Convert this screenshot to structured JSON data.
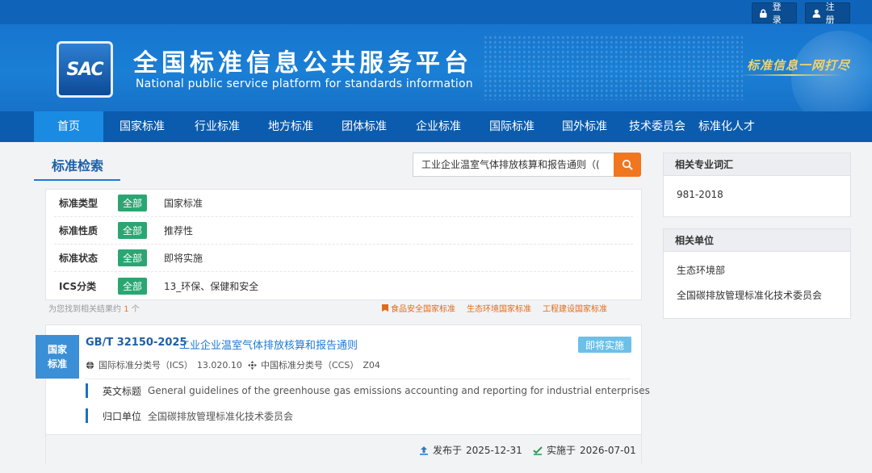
{
  "header": {
    "login_label": "登录",
    "register_label": "注册",
    "logo_text": "SAC",
    "site_title": "全国标准信息公共服务平台",
    "site_subtitle": "National public service platform  for standards information",
    "slogan": "标准信息一网打尽"
  },
  "nav": {
    "items": [
      {
        "label": "首页"
      },
      {
        "label": "国家标准"
      },
      {
        "label": "行业标准"
      },
      {
        "label": "地方标准"
      },
      {
        "label": "团体标准"
      },
      {
        "label": "企业标准"
      },
      {
        "label": "国际标准"
      },
      {
        "label": "国外标准"
      },
      {
        "label": "技术委员会"
      },
      {
        "label": "标准化人才"
      }
    ]
  },
  "search": {
    "title": "标准检索",
    "query": "工业企业温室气体排放核算和报告通则（("
  },
  "filters": [
    {
      "label": "标准类型",
      "tag": "全部",
      "value": "国家标准"
    },
    {
      "label": "标准性质",
      "tag": "全部",
      "value": "推荐性"
    },
    {
      "label": "标准状态",
      "tag": "全部",
      "value": "即将实施"
    },
    {
      "label": "ICS分类",
      "tag": "全部",
      "value": "13_环保、保健和安全"
    }
  ],
  "results": {
    "count_prefix": "为您找到相关结果约",
    "count": "1",
    "count_suffix": "个",
    "related_links": [
      "食品安全国家标准",
      "生态环境国家标准",
      "工程建设国家标准"
    ]
  },
  "card": {
    "badge_line1": "国家",
    "badge_line2": "标准",
    "code": "GB/T 32150-2025",
    "name": "工业企业温室气体排放核算和报告通则",
    "status": "即将实施",
    "ics_label": "国际标准分类号（ICS）",
    "ics_value": "13.020.10",
    "ccs_label": "中国标准分类号（CCS）",
    "ccs_value": "Z04",
    "english_label": "英文标题",
    "english_value": "General guidelines of the greenhouse gas emissions accounting and reporting for industrial enterprises",
    "dept_label": "归口单位",
    "dept_value": "全国碳排放管理标准化技术委员会",
    "publish_label": "发布于",
    "publish_date": "2025-12-31",
    "implement_label": "实施于",
    "implement_date": "2026-07-01"
  },
  "sidebar": {
    "terms_title": "相关专业词汇",
    "terms": [
      "981-2018"
    ],
    "units_title": "相关单位",
    "units": [
      "生态环境部",
      "全国碳排放管理标准化技术委员会"
    ]
  },
  "colors": {
    "primary": "#0b5cae",
    "accent": "#f0761f",
    "tag_green": "#2ba672",
    "status_blue": "#6cc0e8"
  }
}
